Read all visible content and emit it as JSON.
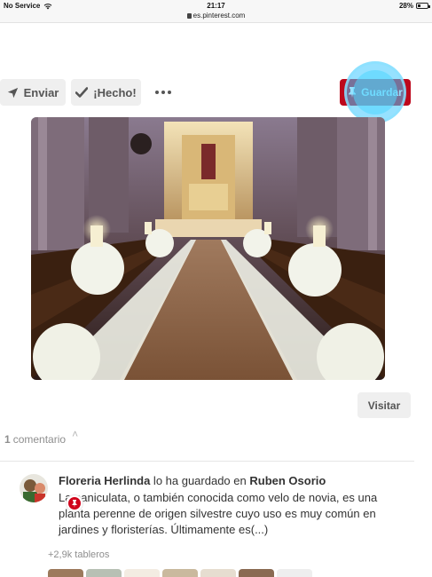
{
  "statusbar": {
    "carrier": "No Service",
    "time": "21:17",
    "url": "es.pinterest.com",
    "battery": "28%",
    "battery_level": 0.28
  },
  "actions": {
    "send_label": "Enviar",
    "done_label": "¡Hecho!",
    "save_label": "Guardar",
    "visit_label": "Visitar"
  },
  "comments": {
    "count": "1",
    "label": "comentario"
  },
  "saver": {
    "name": "Floreria Herlinda",
    "action_text": " lo ha guardado en ",
    "board": "Ruben Osorio",
    "description": "La paniculata, o también conocida como velo de novia, es una planta perenne de origen silvestre cuyo uso es muy común en jardines y floristerías. Últimamente es(...)",
    "boards_count": "+2,9k tableros"
  },
  "colors": {
    "brand_red": "#bd081c",
    "button_gray": "#efefef"
  },
  "icons": [
    "wifi-icon",
    "lock-icon",
    "battery-icon",
    "send-icon",
    "checkmark-icon",
    "more-icon",
    "pin-icon",
    "visual-search-icon",
    "chevron-up-icon",
    "badge-icon"
  ]
}
